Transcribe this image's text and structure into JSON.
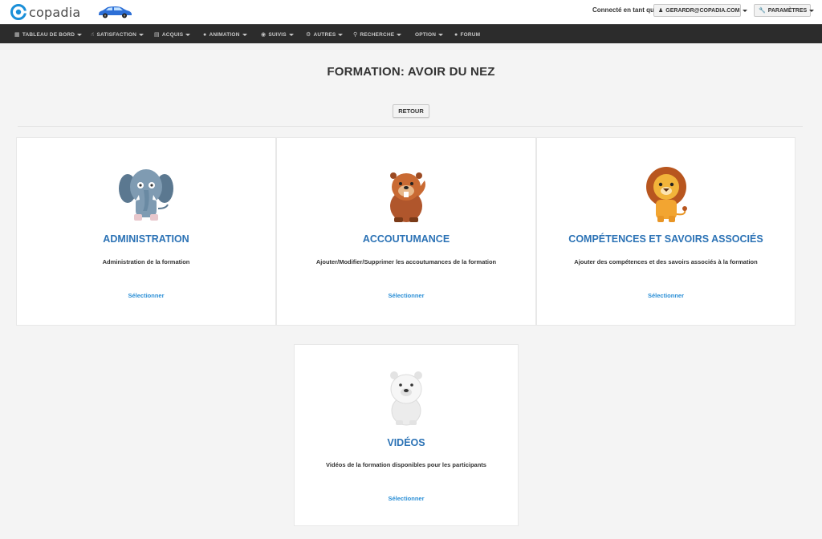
{
  "header": {
    "logo_text": "copadia",
    "connected_label": "Connecté en tant que",
    "user_label": "GERARDR@COPADIA.COM",
    "params_label": "PARAMÈTRES",
    "colors": {
      "brand": "#2b72b5",
      "logo_blue": "#1a8fd8"
    }
  },
  "nav": {
    "items": [
      {
        "label": "TABLEAU DE BORD",
        "icon": "dashboard-icon"
      },
      {
        "label": "SATISFACTION",
        "icon": "thumbs-up-icon"
      },
      {
        "label": "ACQUIS",
        "icon": "chart-icon"
      },
      {
        "label": "ANIMATION",
        "icon": "gamepad-icon"
      },
      {
        "label": "SUIVIS",
        "icon": "binoculars-icon"
      },
      {
        "label": "AUTRES",
        "icon": "gear-icon"
      },
      {
        "label": "RECHERCHE",
        "icon": "search-icon"
      },
      {
        "label": "OPTION",
        "icon": ""
      },
      {
        "label": "FORUM",
        "icon": "chat-icon"
      }
    ]
  },
  "page": {
    "title": "FORMATION: AVOIR DU NEZ",
    "back_label": "RETOUR"
  },
  "cards": [
    {
      "title": "ADMINISTRATION",
      "desc": "Administration de la formation",
      "select": "Sélectionner",
      "animal": "elephant-icon"
    },
    {
      "title": "ACCOUTUMANCE",
      "desc": "Ajouter/Modifier/Supprimer les accoutumances de la formation",
      "select": "Sélectionner",
      "animal": "beaver-icon"
    },
    {
      "title": "COMPÉTENCES ET SAVOIRS ASSOCIÉS",
      "desc": "Ajouter des compétences et des savoirs associés à la formation",
      "select": "Sélectionner",
      "animal": "lion-icon"
    },
    {
      "title": "VIDÉOS",
      "desc": "Vidéos de la formation disponibles pour les participants",
      "select": "Sélectionner",
      "animal": "polar-bear-icon"
    }
  ]
}
